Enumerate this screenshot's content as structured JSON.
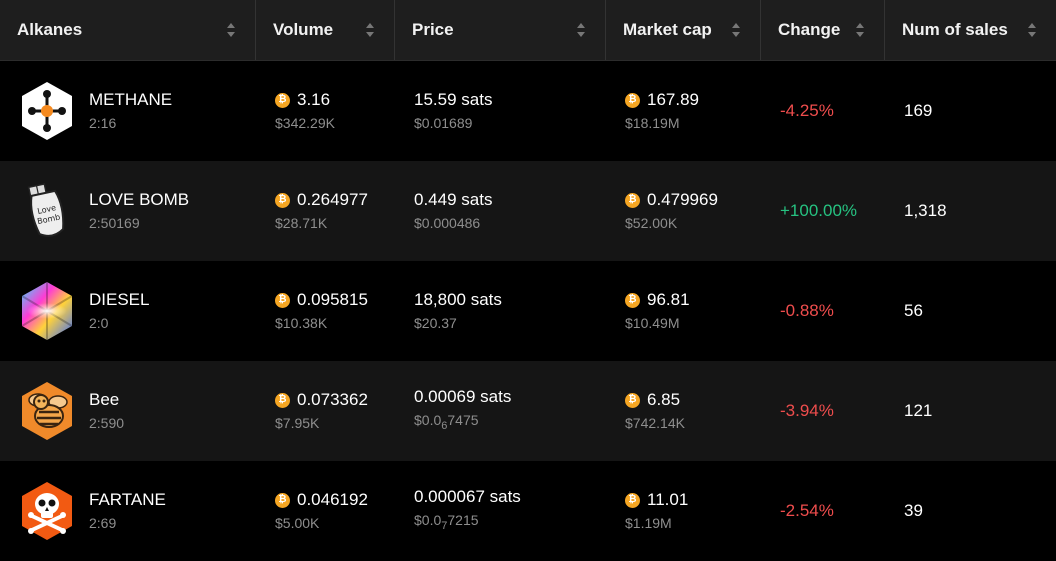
{
  "headers": {
    "alkanes": "Alkanes",
    "volume": "Volume",
    "price": "Price",
    "market_cap": "Market cap",
    "change": "Change",
    "num_sales": "Num of sales"
  },
  "colors": {
    "negative": "#ef4d4d",
    "positive": "#26c281",
    "btc": "#f5a623"
  },
  "rows": [
    {
      "name": "METHANE",
      "id": "2:16",
      "volume_btc": "3.16",
      "volume_usd": "$342.29K",
      "price": "15.59 sats",
      "price_usd": "$0.01689",
      "mcap_btc": "167.89",
      "mcap_usd": "$18.19M",
      "change": "-4.25%",
      "sales": "169",
      "icon": "methane-molecule-icon"
    },
    {
      "name": "LOVE BOMB",
      "id": "2:50169",
      "volume_btc": "0.264977",
      "volume_usd": "$28.71K",
      "price": "0.449 sats",
      "price_usd": "$0.000486",
      "mcap_btc": "0.479969",
      "mcap_usd": "$52.00K",
      "change": "+100.00%",
      "sales": "1,318",
      "icon": "love-bomb-icon"
    },
    {
      "name": "DIESEL",
      "id": "2:0",
      "volume_btc": "0.095815",
      "volume_usd": "$10.38K",
      "price": "18,800 sats",
      "price_usd": "$20.37",
      "mcap_btc": "96.81",
      "mcap_usd": "$10.49M",
      "change": "-0.88%",
      "sales": "56",
      "icon": "diesel-prism-icon"
    },
    {
      "name": "Bee",
      "id": "2:590",
      "volume_btc": "0.073362",
      "volume_usd": "$7.95K",
      "price": "0.00069 sats",
      "price_usd_prefix": "$0.0",
      "price_usd_zeros": "6",
      "price_usd_rest": "7475",
      "mcap_btc": "6.85",
      "mcap_usd": "$742.14K",
      "change": "-3.94%",
      "sales": "121",
      "icon": "bee-icon"
    },
    {
      "name": "FARTANE",
      "id": "2:69",
      "volume_btc": "0.046192",
      "volume_usd": "$5.00K",
      "price": "0.000067 sats",
      "price_usd_prefix": "$0.0",
      "price_usd_zeros": "7",
      "price_usd_rest": "7215",
      "mcap_btc": "11.01",
      "mcap_usd": "$1.19M",
      "change": "-2.54%",
      "sales": "39",
      "icon": "skull-crossbones-icon"
    }
  ]
}
